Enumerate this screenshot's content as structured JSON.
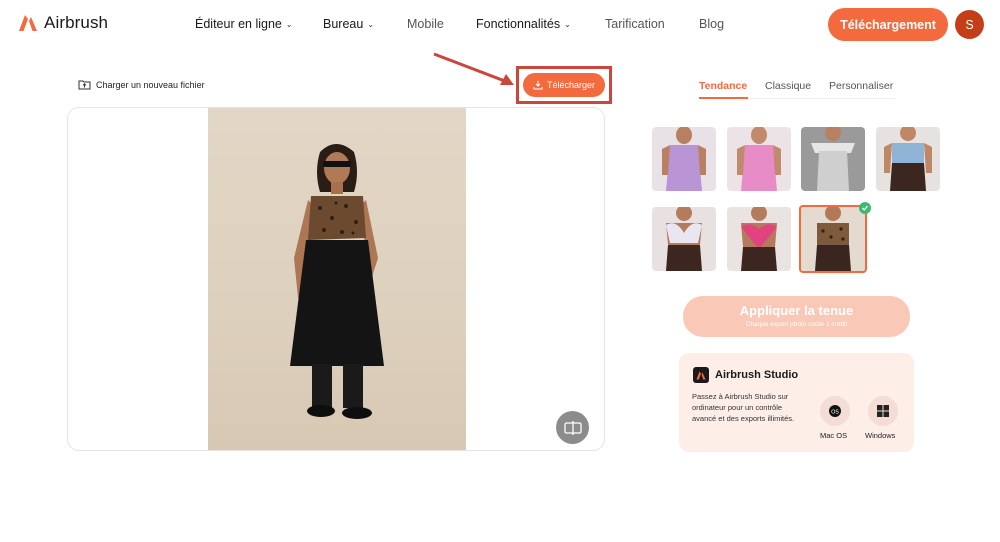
{
  "brand": {
    "name": "Airbrush",
    "accent": "#f26a3d"
  },
  "nav": [
    {
      "label": "Éditeur en ligne",
      "dropdown": true
    },
    {
      "label": "Bureau",
      "dropdown": true
    },
    {
      "label": "Mobile",
      "dropdown": false
    },
    {
      "label": "Fonctionnalités",
      "dropdown": true
    },
    {
      "label": "Tarification",
      "dropdown": false
    },
    {
      "label": "Blog",
      "dropdown": false
    }
  ],
  "header": {
    "download_label": "Téléchargement",
    "avatar_initial": "S"
  },
  "editor": {
    "upload_label": "Charger un nouveau fichier",
    "download_label": "Télécharger"
  },
  "panel": {
    "tabs": [
      {
        "label": "Tendance",
        "active": true
      },
      {
        "label": "Classique",
        "active": false
      },
      {
        "label": "Personnaliser",
        "active": false
      }
    ],
    "outfits": [
      {
        "name": "lilac-satin-slip",
        "color": "#b995d6",
        "selected": false
      },
      {
        "name": "pink-satin-slip",
        "color": "#e88cc8",
        "selected": false
      },
      {
        "name": "silver-sequin-dress",
        "color": "#bdbdbd",
        "selected": false
      },
      {
        "name": "denim-corset-top",
        "color": "#8fb4d6",
        "selected": false
      },
      {
        "name": "white-butterfly-top",
        "color": "#e9e6f2",
        "selected": false
      },
      {
        "name": "pink-heart-top",
        "color": "#e2437e",
        "selected": false
      },
      {
        "name": "leopard-halter-top",
        "color": "#7d5a3c",
        "selected": true
      }
    ],
    "apply_label": "Appliquer la tenue",
    "apply_sub": "Chaque export photo coûte 1 crédit"
  },
  "studio": {
    "title": "Airbrush Studio",
    "description": "Passez à Airbrush Studio sur ordinateur pour un contrôle avancé et des exports illimités.",
    "mac_label": "Mac OS",
    "windows_label": "Windows"
  }
}
